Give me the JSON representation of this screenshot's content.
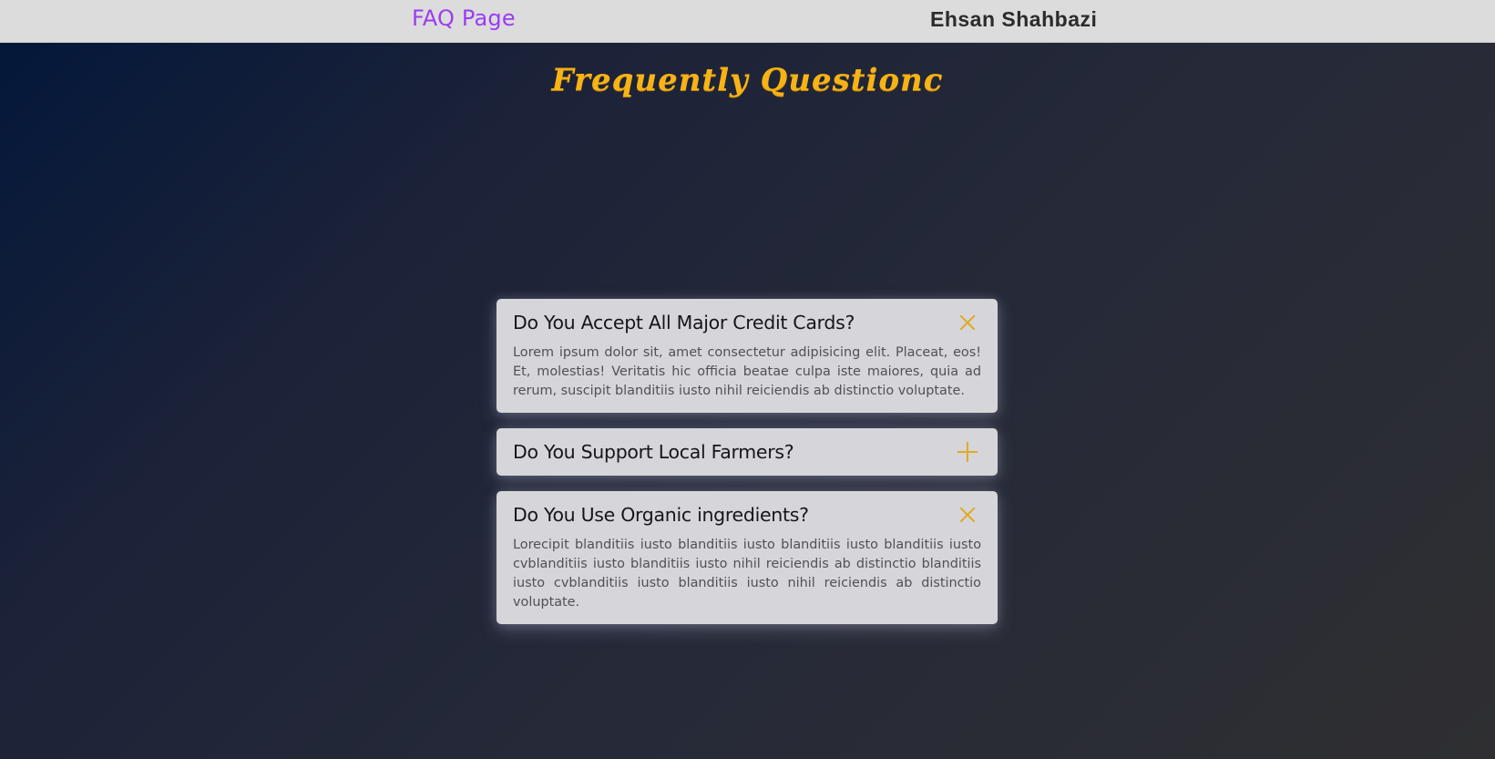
{
  "nav": {
    "brand": "FAQ Page",
    "author": "Ehsan Shahbazi"
  },
  "page": {
    "heading": "Frequently Questionc"
  },
  "faq": [
    {
      "question": "Do You Accept All Major Credit Cards?",
      "answer": "Lorem ipsum dolor sit, amet consectetur adipisicing elit. Placeat, eos! Et, molestias! Veritatis hic officia beatae culpa iste maiores, quia ad rerum, suscipit blanditiis iusto nihil reiciendis ab distinctio voluptate.",
      "expanded": true,
      "icon": "close-icon"
    },
    {
      "question": "Do You Support Local Farmers?",
      "answer": "",
      "expanded": false,
      "icon": "plus-icon"
    },
    {
      "question": "Do You Use Organic ingredients?",
      "answer": "Lorecipit blanditiis iusto blanditiis iusto blanditiis iusto blanditiis iusto cvblanditiis iusto blanditiis iusto nihil reiciendis ab distinctio blanditiis iusto cvblanditiis iusto blanditiis iusto nihil reiciendis ab distinctio voluptate.",
      "expanded": true,
      "icon": "close-icon"
    }
  ],
  "colors": {
    "accent": "#f7b316",
    "brand": "#9b3cf2",
    "icon": "#e2a826",
    "card": "#d6d6da",
    "topbar": "#dcdcdc"
  }
}
